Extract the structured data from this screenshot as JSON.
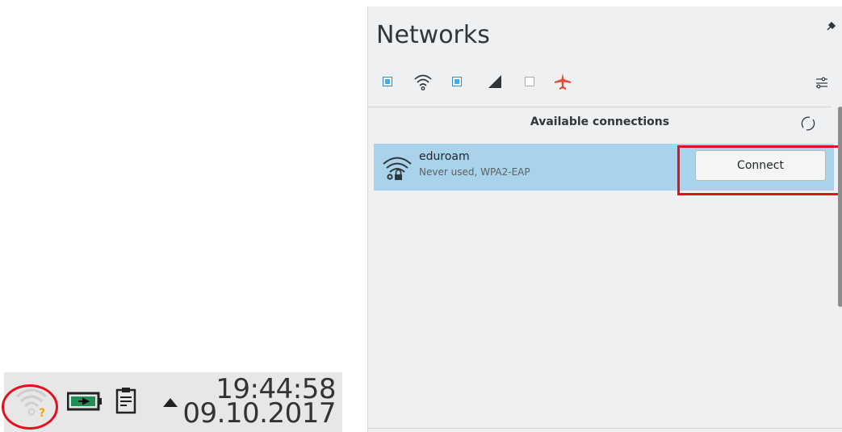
{
  "taskbar": {
    "clock_time": "19:44:58",
    "clock_date": "09.10.2017",
    "icons": [
      "wifi-unknown-icon",
      "battery-charging-icon",
      "clipboard-icon",
      "tray-expand-arrow-icon"
    ]
  },
  "panel": {
    "title": "Networks",
    "toolbar": {
      "wifi_checkbox_checked": true,
      "mobile_checkbox_checked": true,
      "airplane_checkbox_checked": false,
      "icons": [
        "wifi-icon",
        "mobile-signal-icon",
        "airplane-mode-icon",
        "network-settings-icon"
      ]
    },
    "section_header": "Available connections",
    "connections": [
      {
        "name": "eduroam",
        "detail": "Never used, WPA2-EAP",
        "action_label": "Connect",
        "selected": true
      }
    ]
  },
  "colors": {
    "selection": "#a8d3ea",
    "highlight_annotation": "#e3101d",
    "checkbox_accent": "#3daee9",
    "airplane_icon": "#e04a3f"
  }
}
